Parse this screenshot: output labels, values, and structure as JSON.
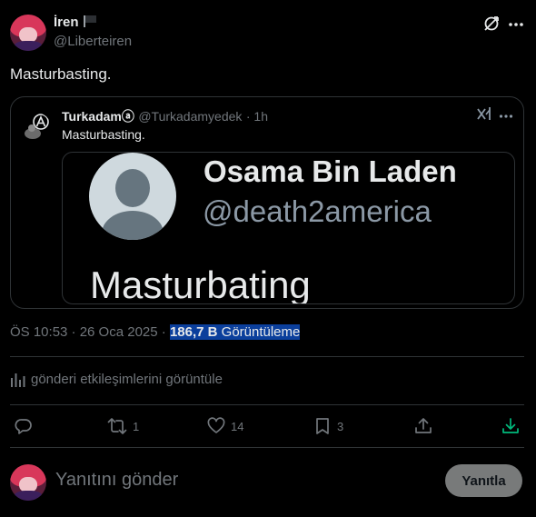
{
  "post": {
    "author_name": "İren",
    "author_handle": "@Liberteiren",
    "text": "Masturbasting.",
    "timestamp": "ÖS 10:53 · 26 Oca 2025 · ",
    "views_count": "186,7 B",
    "views_label": " Görüntüleme"
  },
  "quote": {
    "author_name": "Turkadamⓐ",
    "author_handle": "@Turkadamyedek",
    "time": "· 1h",
    "text": "Masturbasting.",
    "media": {
      "name": "Osama Bin Laden",
      "handle": "@death2america",
      "text": "Masturbating"
    }
  },
  "engagement_link": "gönderi etkileşimlerini görüntüle",
  "actions": {
    "reply_count": "",
    "retweet_count": "1",
    "like_count": "14",
    "bookmark_count": "3"
  },
  "reply_box": {
    "placeholder": "Yanıtını gönder",
    "button_label": "Yanıtla"
  },
  "colors": {
    "background": "#000000",
    "text": "#e7e9ea",
    "muted": "#71767b",
    "border": "#2f3336",
    "selection": "#0b3f9c",
    "download_accent": "#00ba7c"
  }
}
